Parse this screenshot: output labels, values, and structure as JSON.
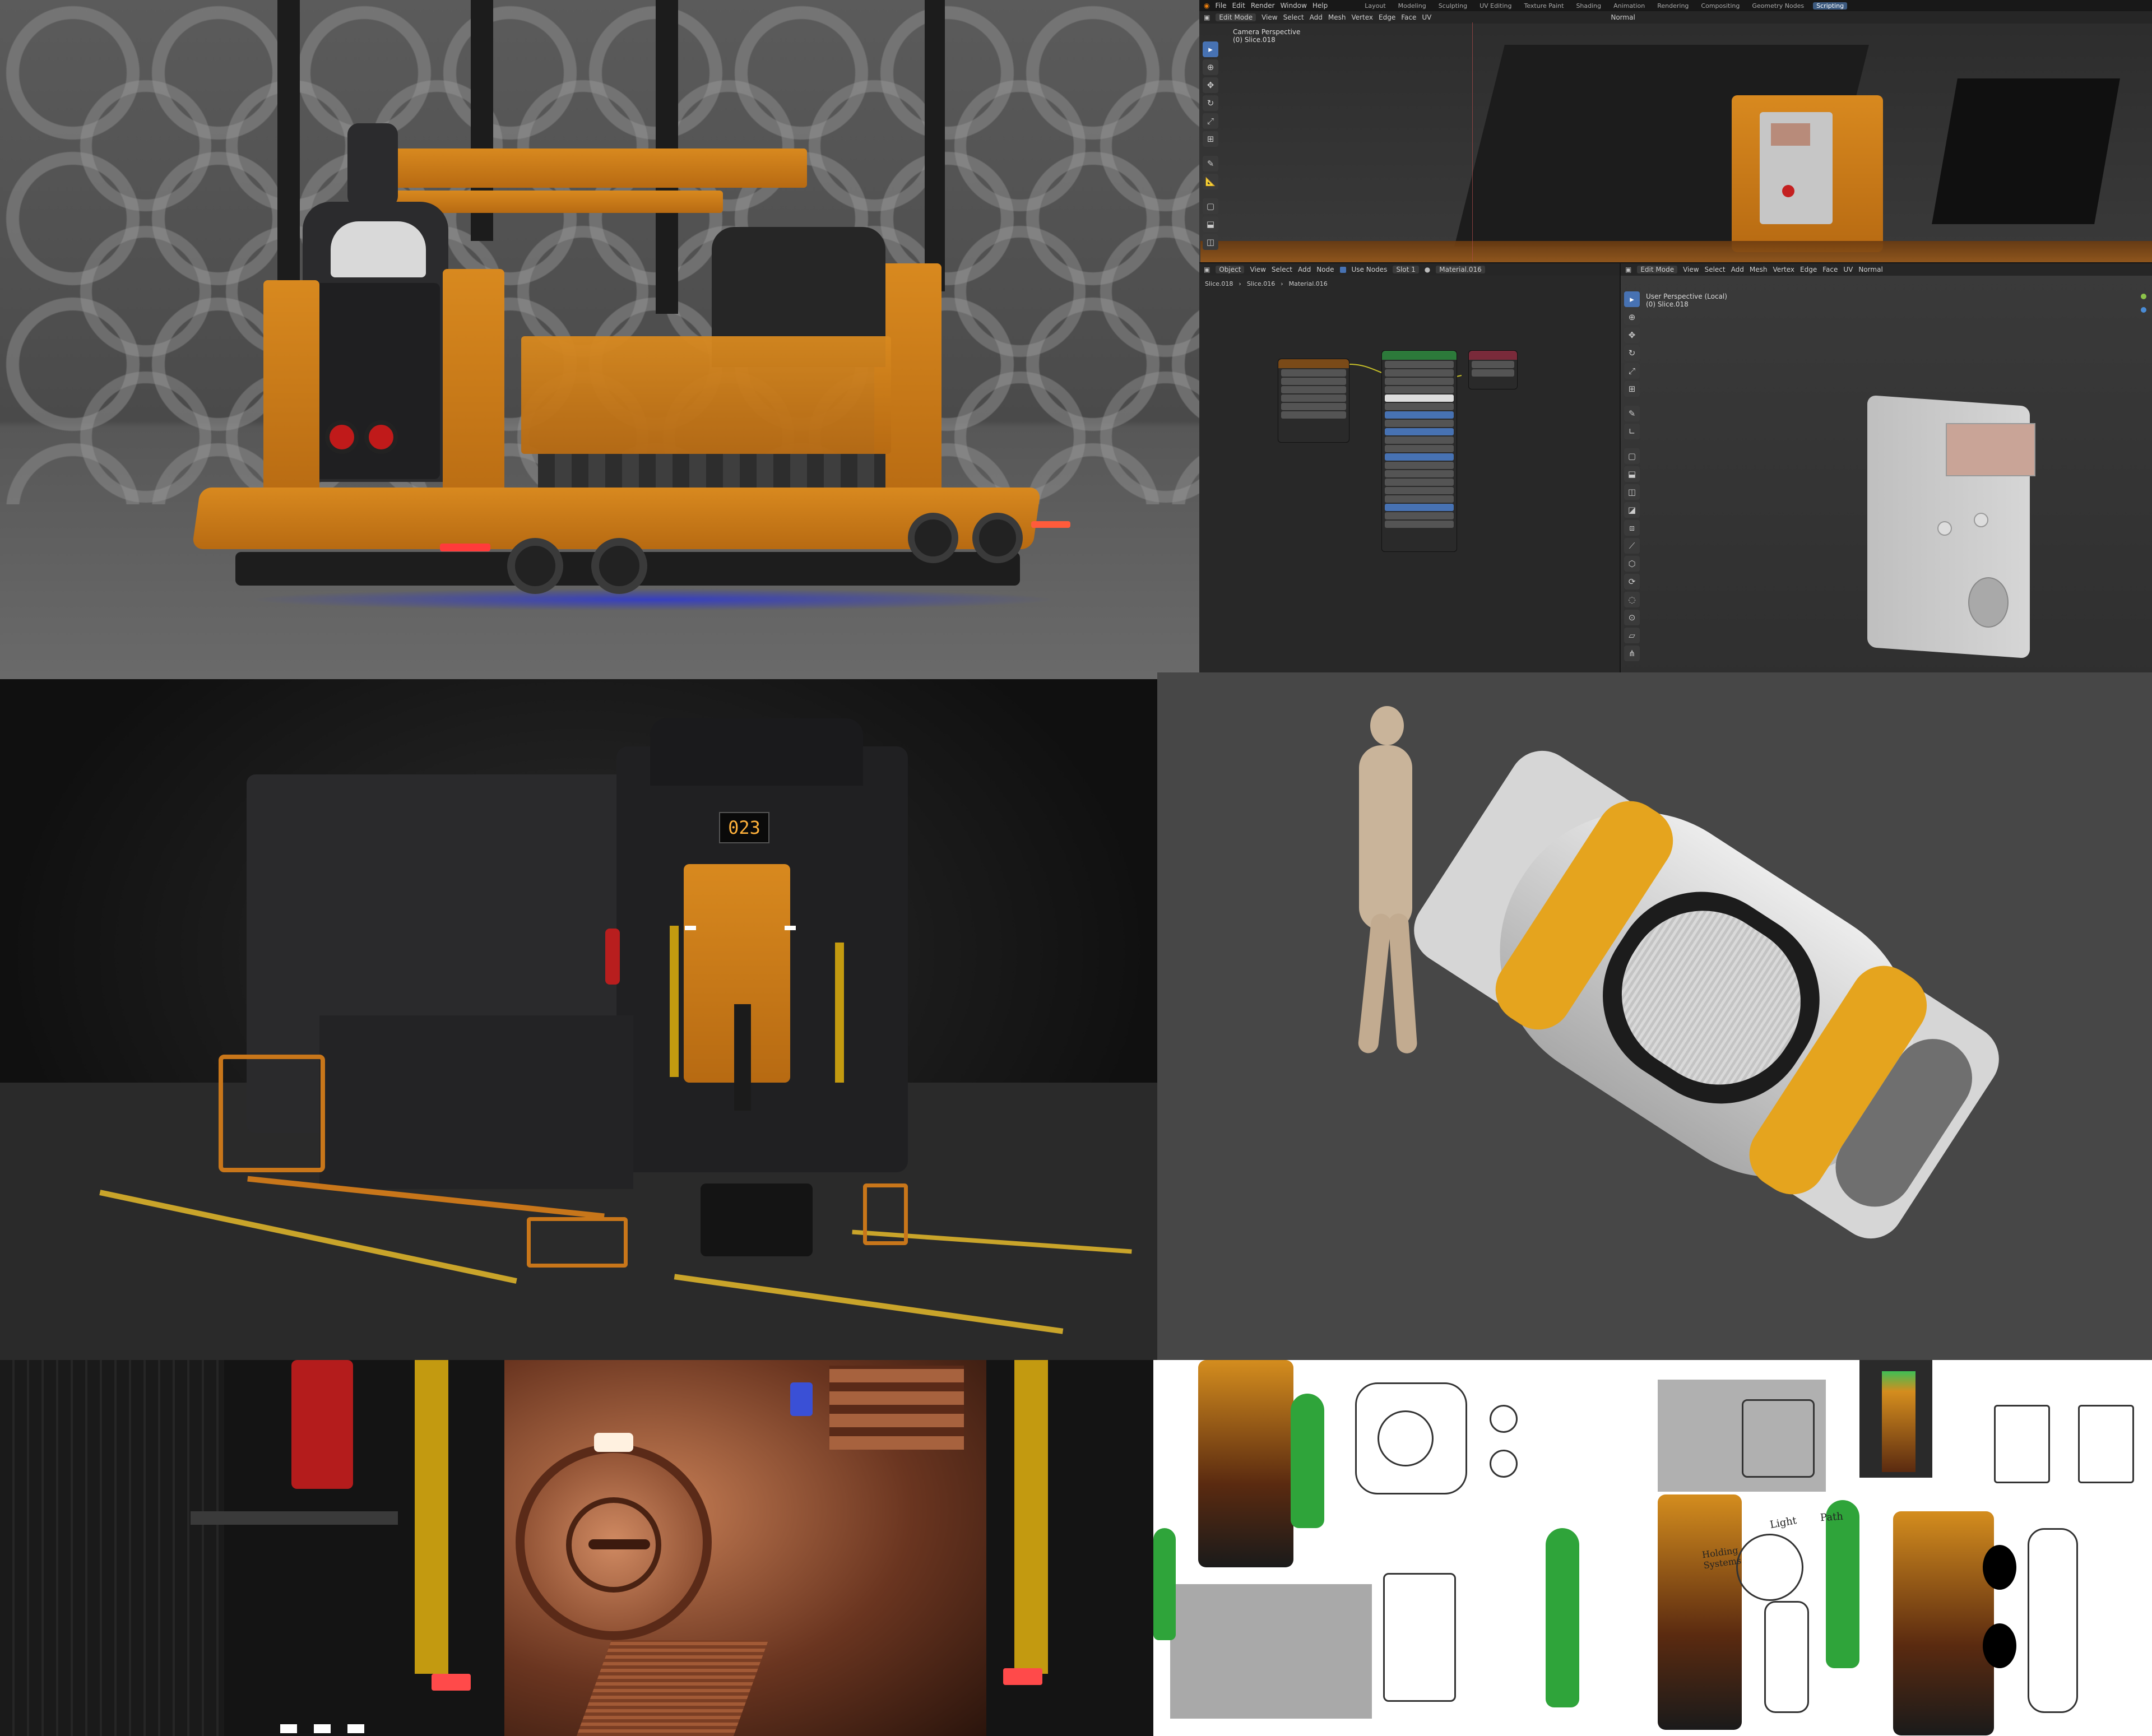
{
  "topbar": {
    "menus": [
      "File",
      "Edit",
      "Render",
      "Window",
      "Help"
    ],
    "workspaces": [
      "Layout",
      "Modeling",
      "Sculpting",
      "UV Editing",
      "Texture Paint",
      "Shading",
      "Animation",
      "Rendering",
      "Compositing",
      "Geometry Nodes",
      "Scripting"
    ],
    "active_workspace": "Scripting",
    "orientation": "Normal"
  },
  "viewport_top": {
    "mode": "Edit Mode",
    "menus": [
      "View",
      "Select",
      "Add",
      "Mesh",
      "Vertex",
      "Edge",
      "Face",
      "UV"
    ],
    "overlay_title": "Camera Perspective",
    "overlay_object": "(0) Slice.018"
  },
  "node_editor": {
    "mode": "Object",
    "menus": [
      "View",
      "Select",
      "Add",
      "Node"
    ],
    "use_nodes_label": "Use Nodes",
    "slot": "Slot 1",
    "material": "Material.016",
    "breadcrumb": [
      "Slice.018",
      "Slice.016",
      "Material.016"
    ]
  },
  "viewport_bottom": {
    "mode": "Edit Mode",
    "menus": [
      "View",
      "Select",
      "Add",
      "Mesh",
      "Vertex",
      "Edge",
      "Face",
      "UV"
    ],
    "orientation": "Normal",
    "overlay_title": "User Perspective (Local)",
    "overlay_object": "(0) Slice.018"
  },
  "renders": {
    "machine_display": "023"
  },
  "concept_sheet": {
    "annotations": [
      "Light",
      "Path",
      "Holding Systems"
    ]
  },
  "icons": [
    "select-box-icon",
    "cursor-icon",
    "move-icon",
    "rotate-icon",
    "scale-icon",
    "transform-icon",
    "annotate-icon",
    "measure-icon",
    "add-cube-icon",
    "extrude-icon",
    "inset-icon",
    "bevel-icon",
    "loop-cut-icon",
    "knife-icon",
    "poly-build-icon",
    "spin-icon",
    "smooth-icon",
    "shrink-icon",
    "shear-icon",
    "rip-icon"
  ],
  "colors": {
    "accent_blue": "#4772b3",
    "safety_orange": "#d8891f",
    "ui_bg": "#303030"
  }
}
